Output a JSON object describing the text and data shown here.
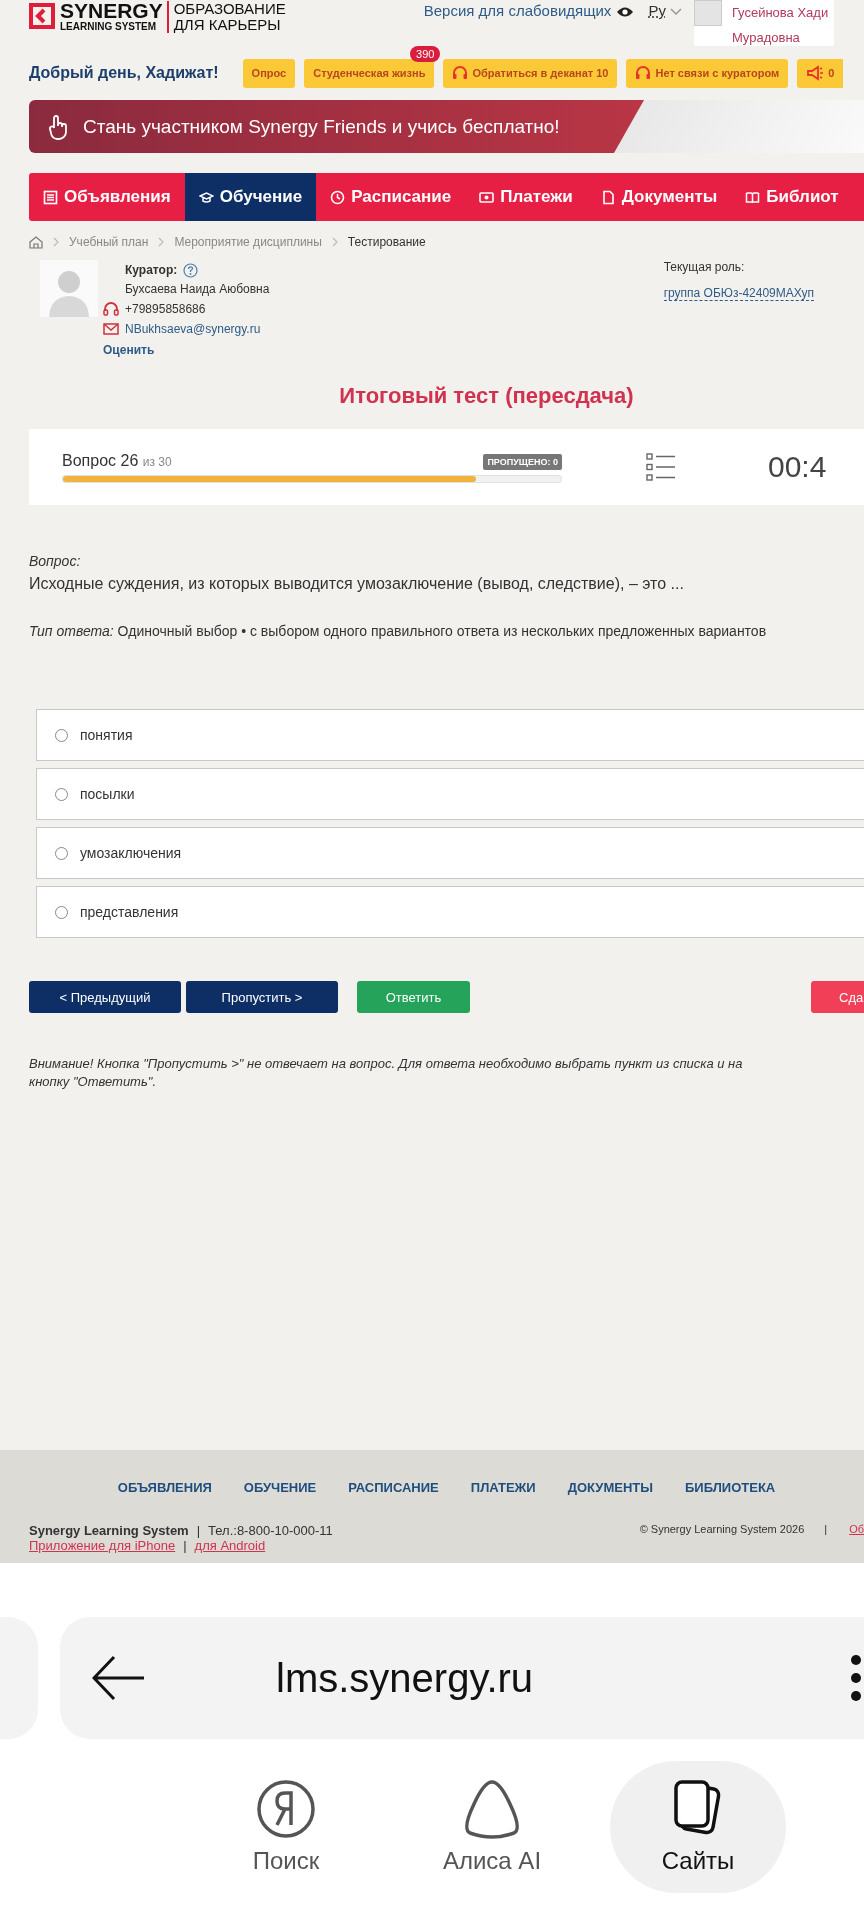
{
  "header": {
    "logo_top": "SYNERGY",
    "logo_bottom": "LEARNING SYSTEM",
    "tagline_top": "ОБРАЗОВАНИЕ",
    "tagline_bottom": "ДЛЯ КАРЬЕРЫ",
    "accessibility": "Версия для слабовидящих",
    "language": "Ру",
    "user_name_1": "Гусейнова Хади",
    "user_name_2": "Мурадовна"
  },
  "greeting": "Добрый день, Хадижат!",
  "quick_buttons": [
    {
      "kind": "plain",
      "label": "Опрос"
    },
    {
      "kind": "plain",
      "label": "Студенческая жизнь",
      "badge": "390"
    },
    {
      "kind": "headset",
      "label": "Обратиться в деканат 10"
    },
    {
      "kind": "headset",
      "label": "Нет связи с куратором"
    },
    {
      "kind": "megaphone",
      "label": "0"
    }
  ],
  "banner": "Стань участником Synergy Friends и учись бесплатно!",
  "nav": [
    {
      "label": "Объявления",
      "selected": false
    },
    {
      "label": "Обучение",
      "selected": true
    },
    {
      "label": "Расписание",
      "selected": false
    },
    {
      "label": "Платежи",
      "selected": false
    },
    {
      "label": "Документы",
      "selected": false
    },
    {
      "label": "Библиот",
      "selected": false
    }
  ],
  "breadcrumbs": [
    {
      "label": "Учебный план",
      "current": false
    },
    {
      "label": "Мероприятие дисциплины",
      "current": false
    },
    {
      "label": "Тестирование",
      "current": true
    }
  ],
  "curator": {
    "label": "Куратор:",
    "name": "Бухсаева Наида Аюбовна",
    "phone": "+79895858686",
    "email": "NBukhsaeva@synergy.ru",
    "rate": "Оценить"
  },
  "role": {
    "label": "Текущая роль:",
    "value": "группа ОБЮз-42409МАХуп"
  },
  "title": "Итоговый тест (пересдача)",
  "progress": {
    "question": "Вопрос 26",
    "of": "из 30",
    "skipped": "ПРОПУЩЕНО: 0",
    "level": 0.83,
    "timer": "00:4"
  },
  "question": {
    "label": "Вопрос:",
    "text": "Исходные суждения, из которых выводится умозаключение (вывод, следствие), – это ...",
    "type_label": "Тип ответа:",
    "type_text": "Одиночный выбор • с выбором одного правильного ответа из нескольких предложенных вариантов"
  },
  "options": [
    {
      "label": "понятия",
      "selected": false
    },
    {
      "label": "посылки",
      "selected": false
    },
    {
      "label": "умозаключения",
      "selected": false
    },
    {
      "label": "представления",
      "selected": false
    }
  ],
  "buttons": [
    {
      "kind": "nav",
      "label": "< Предыдущий"
    },
    {
      "kind": "nav",
      "label": "Пропустить >"
    },
    {
      "kind": "answer",
      "label": "Ответить"
    },
    {
      "kind": "finish",
      "label": "Сда"
    }
  ],
  "note": "Внимание! Кнопка \"Пропустить >\" не отвечает на вопрос. Для ответа необходимо выбрать пункт из списка и на",
  "note_2": "кнопку \"Ответить\".",
  "footer": {
    "links": [
      "ОБЪЯВЛЕНИЯ",
      "ОБУЧЕНИЕ",
      "РАСПИСАНИЕ",
      "ПЛАТЕЖИ",
      "ДОКУМЕНТЫ",
      "БИБЛИОТЕКА"
    ],
    "company": "Synergy Learning System",
    "phone": "Тел.:8-800-10-000-11",
    "iphone": "Приложение для iPhone",
    "android": "для Android",
    "copyright": "© Synergy Learning System 2026",
    "cut_link": "Об",
    "separators": [
      "|",
      "|",
      "|"
    ]
  },
  "browser": {
    "url": "lms.synergy.ru",
    "tabs": [
      {
        "label": "Поиск",
        "selected": false
      },
      {
        "label": "Алиса AI",
        "selected": false
      },
      {
        "label": "Сайты",
        "selected": true
      }
    ]
  }
}
